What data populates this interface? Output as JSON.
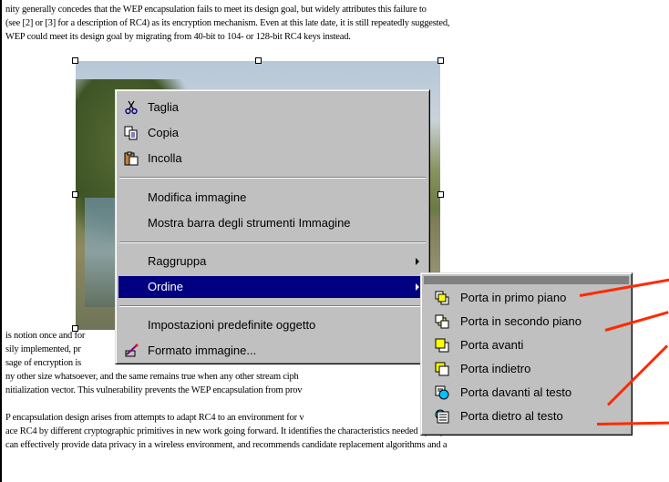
{
  "document": {
    "lines_top": [
      "nity generally concedes that the WEP encapsulation fails to meet its design goal, but widely attributes this failure to",
      "(see [2] or [3] for a description of RC4) as its encryption mechanism. Even at this late date, it is still repeatedly suggested,",
      " WEP could meet its design goal by migrating from 40-bit to 104- or 128-bit RC4 keys instead."
    ],
    "lines_mid": [
      "is notion once and for",
      "sily implemented, pr",
      "sage of encryption is",
      "ny other size whatsoever, and the same remains true when any other stream ciph",
      "nitialization vector. This vulnerability prevents the WEP encapsulation from prov"
    ],
    "lines_bottom": [
      "P encapsulation design arises from attempts to adapt RC4 to an environment for v",
      "ace RC4 by different cryptographic primitives in new work going forward. It identifies the characteristics needed by any",
      "can effectively provide data privacy in a wireless environment, and recommends candidate replacement algorithms and a"
    ]
  },
  "context_menu": {
    "cut": "Taglia",
    "copy": "Copia",
    "paste": "Incolla",
    "edit_image": "Modifica immagine",
    "show_image_toolbar": "Mostra barra degli strumenti Immagine",
    "group": "Raggruppa",
    "order": "Ordine",
    "default_settings": "Impostazioni predefinite oggetto",
    "format_image": "Formato immagine..."
  },
  "order_submenu": {
    "items": [
      "Porta in primo piano",
      "Porta in secondo piano",
      "Porta avanti",
      "Porta indietro",
      "Porta davanti al testo",
      "Porta dietro al testo"
    ]
  },
  "colors": {
    "menu_bg": "#c0c0c0",
    "highlight": "#000080",
    "callout": "#ff2a00"
  },
  "icons": {
    "cut": "scissors-icon",
    "copy": "copy-icon",
    "paste": "paste-icon",
    "format_image": "format-picture-icon",
    "bring_to_front": "bring-to-front-icon",
    "send_to_back": "send-to-back-icon",
    "bring_forward": "bring-forward-icon",
    "send_backward": "send-backward-icon",
    "in_front_of_text": "bring-in-front-of-text-icon",
    "behind_text": "send-behind-text-icon"
  }
}
